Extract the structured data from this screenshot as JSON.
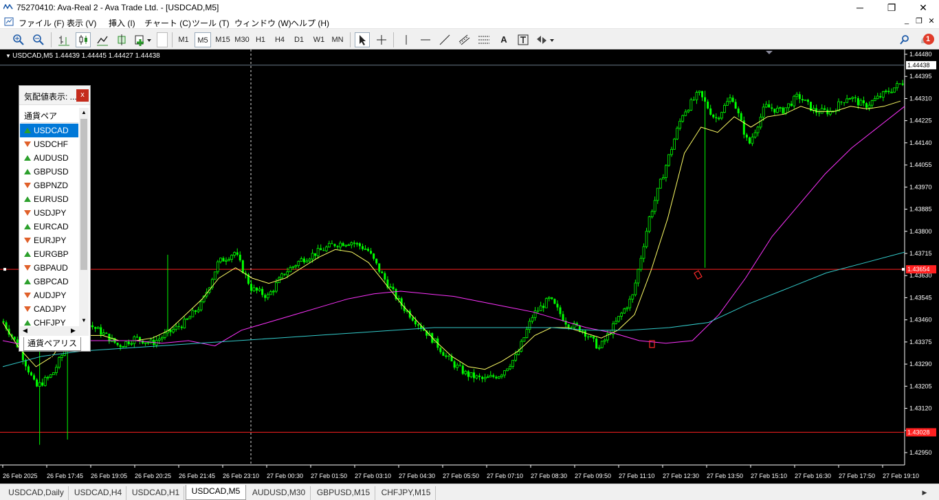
{
  "window": {
    "title": "75270410: Ava-Real 2 - Ava Trade Ltd. - [USDCAD,M5]",
    "minimize": "─",
    "maximize": "❐",
    "close": "✕"
  },
  "menu": [
    "ファイル (F)",
    "表示 (V)",
    "挿入 (I)",
    "チャート (C)",
    "ツール (T)",
    "ウィンドウ (W)",
    "ヘルプ (H)"
  ],
  "mdi": {
    "minimize": "_",
    "restore": "❐",
    "close": "✕"
  },
  "toolbar": {
    "timeframes": [
      "M1",
      "M5",
      "M15",
      "M30",
      "H1",
      "H4",
      "D1",
      "W1",
      "MN"
    ],
    "active_tf": "M5",
    "text_tool": "A",
    "notif_count": "1"
  },
  "chart": {
    "symbol_line": "USDCAD,M5  1.44439 1.44445 1.44427 1.44438",
    "price_labels": [
      "1.44480",
      "1.44395",
      "1.44310",
      "1.44225",
      "1.44140",
      "1.44055",
      "1.43970",
      "1.43885",
      "1.43800",
      "1.43715",
      "1.43630",
      "1.43545",
      "1.43460",
      "1.43375",
      "1.43290",
      "1.43205",
      "1.43120",
      "1.43035",
      "1.42950"
    ],
    "current_price": "1.44438",
    "hline_upper": "1.43654",
    "hline_lower": "1.43028",
    "time_labels": [
      "26 Feb 2025",
      "26 Feb 17:45",
      "26 Feb 19:05",
      "26 Feb 20:25",
      "26 Feb 21:45",
      "26 Feb 23:10",
      "27 Feb 00:30",
      "27 Feb 01:50",
      "27 Feb 03:10",
      "27 Feb 04:30",
      "27 Feb 05:50",
      "27 Feb 07:10",
      "27 Feb 08:30",
      "27 Feb 09:50",
      "27 Feb 11:10",
      "27 Feb 12:30",
      "27 Feb 13:50",
      "27 Feb 15:10",
      "27 Feb 16:30",
      "27 Feb 17:50",
      "27 Feb 19:10"
    ],
    "colors": {
      "bull": "#00ff00",
      "bear": "#00ff00",
      "ma_fast": "#ffff66",
      "ma_mid": "#ff33ff",
      "ma_slow": "#33cccc",
      "hline": "#ff2020",
      "bg": "#000000"
    }
  },
  "chart_data": {
    "type": "candlestick",
    "ylim": [
      1.4295,
      1.4448
    ],
    "close": [
      1.43455,
      1.4335,
      1.432,
      1.4325,
      1.4338,
      1.4345,
      1.4341,
      1.4336,
      1.4339,
      1.4337,
      1.4341,
      1.4345,
      1.4352,
      1.4368,
      1.4372,
      1.4358,
      1.4355,
      1.4364,
      1.4369,
      1.4372,
      1.4375,
      1.4376,
      1.4373,
      1.4362,
      1.4352,
      1.4345,
      1.4338,
      1.433,
      1.4325,
      1.4323,
      1.4325,
      1.4332,
      1.4348,
      1.4354,
      1.4345,
      1.4342,
      1.4335,
      1.4345,
      1.4355,
      1.4385,
      1.4405,
      1.4425,
      1.4433,
      1.4423,
      1.4432,
      1.4413,
      1.4428,
      1.4426,
      1.4432,
      1.4426,
      1.4426,
      1.4432,
      1.4428,
      1.4432,
      1.4436
    ],
    "ma_fast": [
      1.4345,
      1.4335,
      1.4328,
      1.4332,
      1.4342,
      1.434,
      1.434,
      1.4338,
      1.4338,
      1.4339,
      1.4342,
      1.4348,
      1.4354,
      1.4362,
      1.4366,
      1.4362,
      1.436,
      1.4362,
      1.4366,
      1.437,
      1.4373,
      1.4372,
      1.4368,
      1.436,
      1.4352,
      1.4345,
      1.4338,
      1.4332,
      1.4328,
      1.4327,
      1.433,
      1.4334,
      1.434,
      1.4343,
      1.4343,
      1.4341,
      1.4339,
      1.4342,
      1.4348,
      1.4365,
      1.4385,
      1.441,
      1.442,
      1.4418,
      1.4424,
      1.442,
      1.4424,
      1.4425,
      1.4428,
      1.4426,
      1.4426,
      1.4428,
      1.4427,
      1.4428,
      1.443
    ],
    "ma_mid": [
      1.4338,
      1.4336,
      1.4337,
      1.4338,
      1.4338,
      1.4338,
      1.4337,
      1.4338,
      1.4336,
      1.4342,
      1.4345,
      1.4348,
      1.4351,
      1.4354,
      1.4356,
      1.4357,
      1.4356,
      1.4355,
      1.4353,
      1.4351,
      1.4349,
      1.4346,
      1.4343,
      1.4341,
      1.4338,
      1.4337,
      1.4338,
      1.4348,
      1.4362,
      1.4378,
      1.439,
      1.4402,
      1.4412,
      1.442,
      1.4428
    ],
    "ma_slow": [
      1.4328,
      1.4332,
      1.4334,
      1.4335,
      1.4336,
      1.4337,
      1.4338,
      1.4339,
      1.434,
      1.4341,
      1.4342,
      1.4343,
      1.4343,
      1.4343,
      1.4343,
      1.4342,
      1.4342,
      1.4343,
      1.4345,
      1.4352,
      1.4358,
      1.4364,
      1.4368,
      1.4372
    ]
  },
  "market_watch": {
    "title": "気配値表示: ...",
    "close": "x",
    "column_header": "通貨ペア",
    "symbols": [
      {
        "name": "USDCAD",
        "dir": "up"
      },
      {
        "name": "USDCHF",
        "dir": "down"
      },
      {
        "name": "AUDUSD",
        "dir": "up"
      },
      {
        "name": "GBPUSD",
        "dir": "up"
      },
      {
        "name": "GBPNZD",
        "dir": "down"
      },
      {
        "name": "EURUSD",
        "dir": "up"
      },
      {
        "name": "USDJPY",
        "dir": "down"
      },
      {
        "name": "EURCAD",
        "dir": "up"
      },
      {
        "name": "EURJPY",
        "dir": "down"
      },
      {
        "name": "EURGBP",
        "dir": "up"
      },
      {
        "name": "GBPAUD",
        "dir": "down"
      },
      {
        "name": "GBPCAD",
        "dir": "up"
      },
      {
        "name": "AUDJPY",
        "dir": "down"
      },
      {
        "name": "CADJPY",
        "dir": "down"
      },
      {
        "name": "CHFJPY",
        "dir": "up"
      }
    ],
    "selected": "USDCAD",
    "tab_label": "通貨ペアリスト"
  },
  "chart_tabs": [
    "USDCAD,Daily",
    "USDCAD,H4",
    "USDCAD,H1",
    "USDCAD,M5",
    "AUDUSD,M30",
    "GBPUSD,M15",
    "CHFJPY,M15"
  ],
  "active_tab": "USDCAD,M5"
}
